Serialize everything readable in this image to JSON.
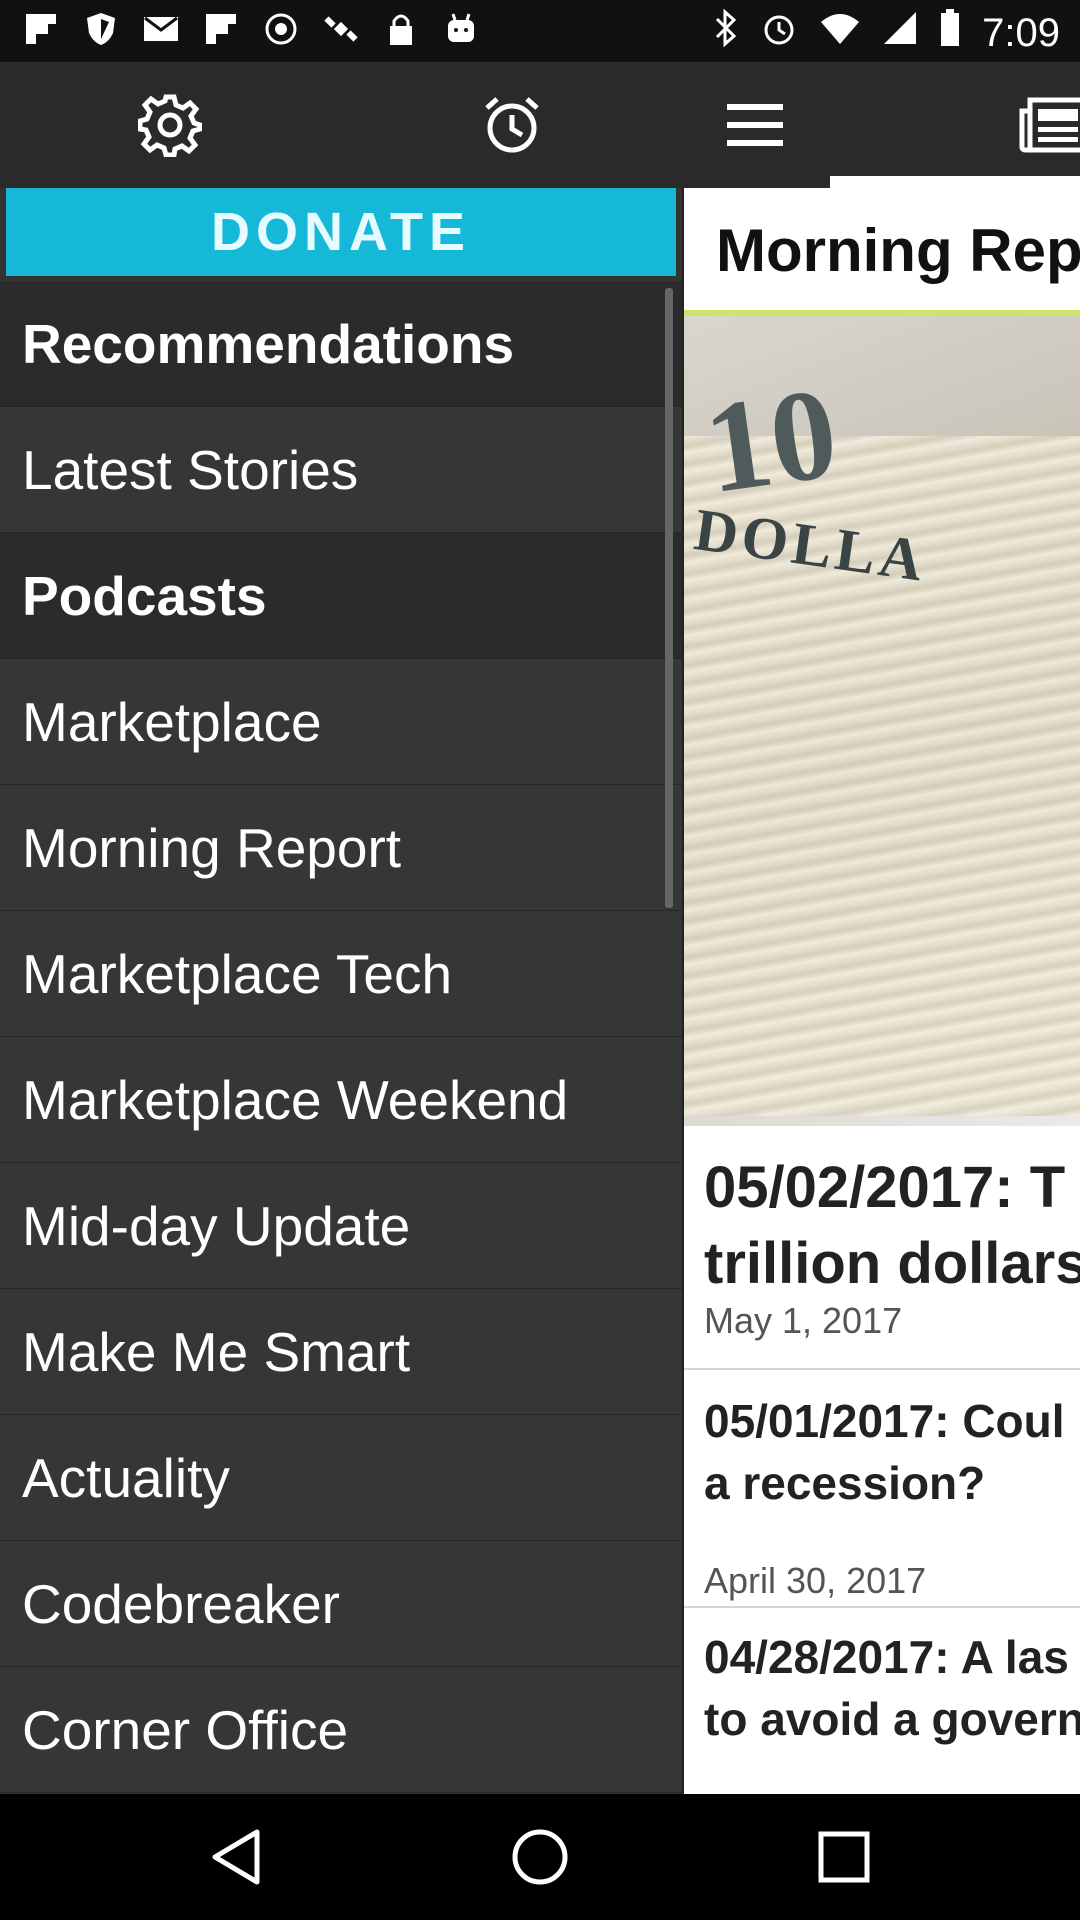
{
  "status_bar": {
    "time": "7:09",
    "left_icons": [
      "flipboard-icon",
      "shield-icon",
      "mail-icon",
      "flipboard-icon",
      "podcast-icon",
      "satellite-icon",
      "lock-icon",
      "android-icon"
    ],
    "right_icons": [
      "bluetooth-icon",
      "alarm-icon",
      "wifi-icon",
      "signal-icon",
      "battery-icon"
    ]
  },
  "toolbar": {
    "settings_icon": "gear-icon",
    "alarm_icon": "alarm-clock-icon",
    "menu_icon": "hamburger-icon",
    "news_icon": "newspaper-icon"
  },
  "drawer": {
    "donate_label": "DONATE",
    "items": [
      {
        "label": "Recommendations",
        "header": true
      },
      {
        "label": "Latest Stories",
        "header": false
      },
      {
        "label": "Podcasts",
        "header": true
      },
      {
        "label": "Marketplace",
        "header": false
      },
      {
        "label": "Morning Report",
        "header": false
      },
      {
        "label": "Marketplace Tech",
        "header": false
      },
      {
        "label": "Marketplace Weekend",
        "header": false
      },
      {
        "label": "Mid-day Update",
        "header": false
      },
      {
        "label": "Make Me Smart",
        "header": false
      },
      {
        "label": "Actuality",
        "header": false
      },
      {
        "label": "Codebreaker",
        "header": false
      },
      {
        "label": "Corner Office",
        "header": false
      }
    ]
  },
  "content": {
    "title": "Morning Rep",
    "hero_text_number": "10",
    "hero_text_word": "DOLLA",
    "articles": [
      {
        "title_line1": "05/02/2017: T",
        "title_line2": "trillion dollars",
        "date": "May 1, 2017"
      },
      {
        "title_line1": "05/01/2017: Coul",
        "title_line2": "a recession?",
        "date": "April 30, 2017"
      },
      {
        "title_line1": "04/28/2017: A las",
        "title_line2": "to avoid a governm",
        "date": ""
      }
    ]
  },
  "nav_bar": {
    "back_icon": "back-triangle-icon",
    "home_icon": "home-circle-icon",
    "recents_icon": "recents-square-icon"
  }
}
